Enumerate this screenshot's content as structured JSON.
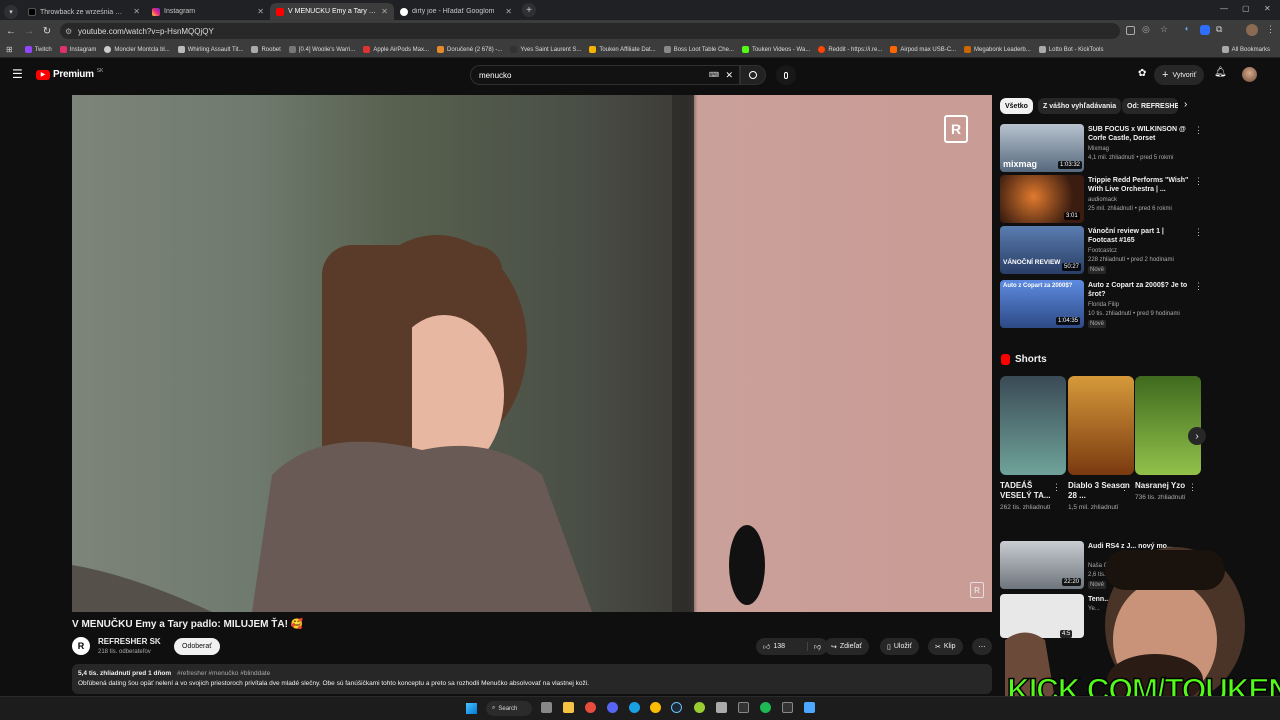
{
  "browser": {
    "tabs": [
      {
        "title": "Throwback ze września 😊🙏 Z..."
      },
      {
        "title": "Instagram"
      },
      {
        "title": "V MENUČKU Emy a Tary padlo:"
      },
      {
        "title": "dirty joe - Hľadať Googlom"
      }
    ],
    "new_tab": "+",
    "url": "youtube.com/watch?v=p-HsnMQQjQY",
    "bookmarks": [
      "Twitch",
      "Instagram",
      "Moncler Montcla bl...",
      "Whirling Assault Tit...",
      "Roobet",
      "[0.4] Woolie's Warri...",
      "Apple AirPods Max...",
      "Doručené (2 678) -...",
      "Yves Saint Laurent S...",
      "Touken Affiliate Dat...",
      "Boss Loot Table Che...",
      "Touken Videos - Wa...",
      "Reddit - https://i.re...",
      "Airpod max USB-C...",
      "Megabonk Leaderb...",
      "Lotto Bot - KickTools"
    ],
    "all_bookmarks": "All Bookmarks"
  },
  "youtube": {
    "logo_text": "Premium",
    "logo_sup": "SK",
    "search_value": "menucko",
    "create_label": "Vytvoriť"
  },
  "video": {
    "title": "V MENUČKU Emy a Tary padlo: MILUJEM ŤA! 🥰",
    "channel": "REFRESHER SK",
    "subscribers": "218 tis. odberateľov",
    "subscribe_label": "Odoberať",
    "likes": "138",
    "share_label": "Zdieľať",
    "save_label": "Uložiť",
    "clip_label": "Klip",
    "views_date": "5,4 tis. zhliadnutí  pred 1 dňom",
    "hashtags": "#refresher #menučko #blinddate",
    "description": "Obľúbená dating šou opäť nelení a vo svojich priestoroch privítala dve mladé slečny. Obe sú fanúšičkami tohto konceptu a preto sa rozhodli Menučko absolvovať na vlastnej koži."
  },
  "chips": [
    "Všetko",
    "Z vášho vyhľadávania",
    "Od: REFRESHER"
  ],
  "related": [
    {
      "title": "SUB FOCUS x WILKINSON @ Corfe Castle, Dorset",
      "channel": "Mixmag",
      "meta": "4,1 mil. zhliadnutí • pred 5 rokmi",
      "duration": "1:03:32",
      "thumb_text": "mixmag",
      "color": "#6a7f9c"
    },
    {
      "title": "Trippie Redd Performs \"Wish\" With Live Orchestra | ...",
      "channel": "audiomack",
      "meta": "25 mil. zhliadnutí • pred 6 rokmi",
      "duration": "3:01",
      "thumb_text": "",
      "color": "#9a3a22"
    },
    {
      "title": "Vánoční review part 1 | Footcast #165",
      "channel": "Footcastcz",
      "meta": "228 zhliadnutí • pred 2 hodinami",
      "duration": "50:27",
      "badge": "Nové",
      "thumb_text": "VÁNOČNÍ REVIEW",
      "color": "#3b5e9a"
    },
    {
      "title": "Auto z Copart za 2000$? Je to šrot?",
      "channel": "Florida Filip",
      "meta": "10 tis. zhliadnutí • pred 9 hodinami",
      "duration": "1:04:35",
      "badge": "Nové",
      "thumb_text": "Auto z Copart za 2000$?",
      "color": "#4b6fb5"
    },
    {
      "title": "Audi RS4 z J... nový mo...",
      "channel": "Naša Ga...",
      "meta": "2,6 tis. zh...",
      "duration": "22:20",
      "badge": "Nové",
      "color": "#9aa0a8"
    },
    {
      "title": "Tenn...",
      "channel": "Ye...",
      "meta": "",
      "duration": "4:5",
      "color": "#ddd"
    }
  ],
  "shorts": {
    "heading": "Shorts",
    "items": [
      {
        "title": "TADEÁŠ VESELÝ TA...",
        "views": "262 tis. zhliadnutí",
        "color": "#5f8f86"
      },
      {
        "title": "Diablo 3 Season 28 ...",
        "views": "1,5 mil. zhliadnutí",
        "color": "#b07030"
      },
      {
        "title": "Nasranej Yzo",
        "views": "736 tis. zhliadnutí",
        "color": "#4f7a2c"
      }
    ]
  },
  "overlay": {
    "kick_text": "KICK.COM/TOUKEN"
  },
  "taskbar": {
    "search_label": "Search"
  },
  "colors": {
    "accent_red": "#ff0000",
    "kick_green": "#53fc18"
  }
}
